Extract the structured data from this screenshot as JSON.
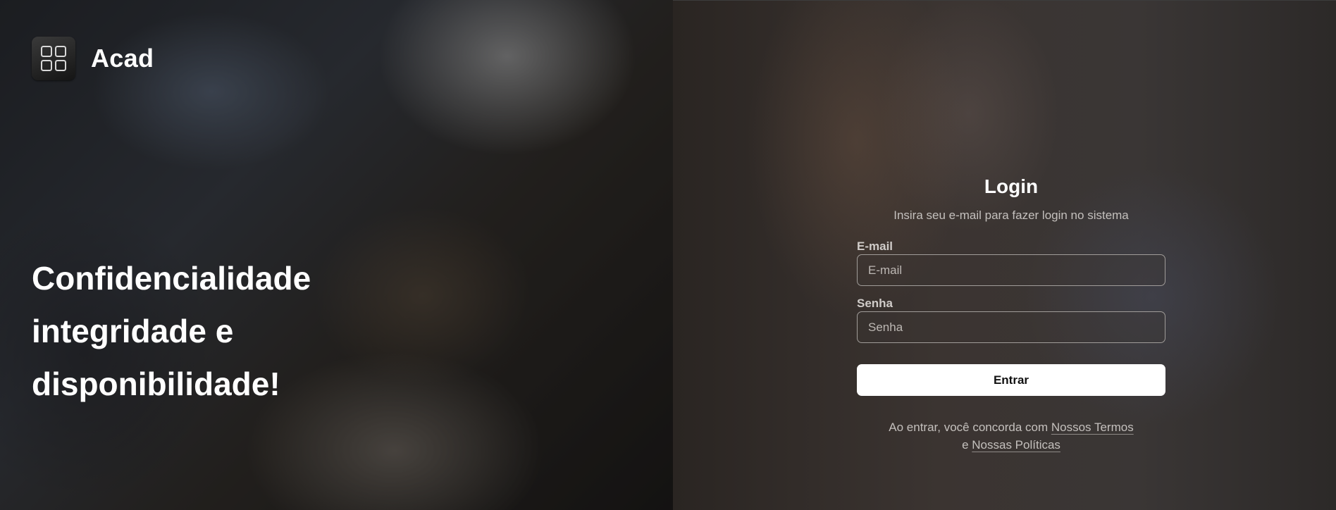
{
  "brand": {
    "name": "Acad",
    "logo_icon": "grid-icon"
  },
  "hero": {
    "headline_line1": "Confidencialidade",
    "headline_line2": "integridade e",
    "headline_line3": "disponibilidade!"
  },
  "login": {
    "title": "Login",
    "subtitle": "Insira seu e-mail para fazer login no sistema",
    "email_label": "E-mail",
    "email_placeholder": "E-mail",
    "email_value": "",
    "password_label": "Senha",
    "password_placeholder": "Senha",
    "password_value": "",
    "submit_label": "Entrar",
    "terms_prefix": "Ao entrar, você concorda com",
    "terms_link": "Nossos Termos",
    "terms_middle": "e",
    "policies_link": "Nossas Políticas"
  },
  "colors": {
    "button_bg": "#ffffff",
    "button_text": "#111111",
    "text_primary": "#ffffff",
    "text_muted": "#c4c0bd"
  }
}
